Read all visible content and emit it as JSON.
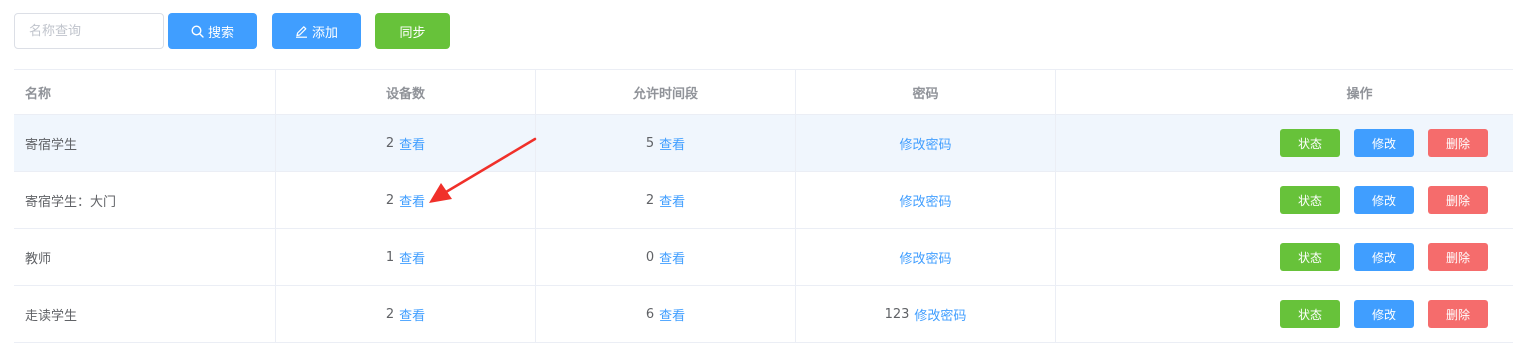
{
  "toolbar": {
    "search_placeholder": "名称查询",
    "search_label": "搜索",
    "add_label": "添加",
    "sync_label": "同步"
  },
  "table": {
    "headers": [
      "名称",
      "设备数",
      "允许时间段",
      "密码",
      "操作"
    ],
    "rows": [
      {
        "name": "寄宿学生",
        "devices": "2",
        "periods": "5",
        "password": ""
      },
      {
        "name": "寄宿学生：大门",
        "devices": "2",
        "periods": "2",
        "password": ""
      },
      {
        "name": "教师",
        "devices": "1",
        "periods": "0",
        "password": ""
      },
      {
        "name": "走读学生",
        "devices": "2",
        "periods": "6",
        "password": "123"
      }
    ],
    "view_label": "查看",
    "change_pwd_label": "修改密码",
    "status_label": "状态",
    "edit_label": "修改",
    "delete_label": "删除"
  },
  "colors": {
    "primary": "#409eff",
    "success": "#67c23a",
    "danger": "#f56c6c",
    "annotation": "#f0302a"
  }
}
